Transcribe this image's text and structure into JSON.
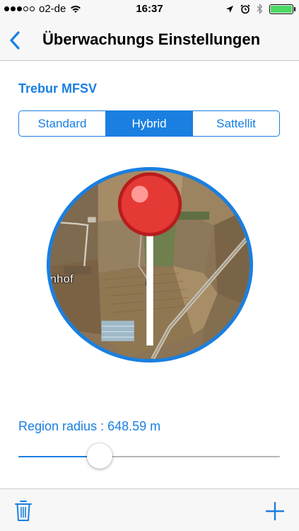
{
  "status_bar": {
    "signal_filled": 3,
    "signal_total": 5,
    "carrier": "o2-de",
    "time": "16:37",
    "icons": [
      "wifi-icon",
      "location-arrow-icon",
      "alarm-icon",
      "bluetooth-icon",
      "battery-icon"
    ],
    "battery_level": 1.0
  },
  "nav": {
    "title": "Überwachungs Einstellungen",
    "back_icon": "chevron-left-icon"
  },
  "location_name": "Trebur MFSV",
  "map_type": {
    "options": [
      "Standard",
      "Hybrid",
      "Sattellit"
    ],
    "selected_index": 1
  },
  "map": {
    "place_label": "kenhof",
    "pin_icon": "map-pin-icon"
  },
  "region": {
    "label": "Region radius : 648.59 m",
    "slider_value": 0.31
  },
  "toolbar": {
    "delete_icon": "trash-icon",
    "add_icon": "plus-icon"
  },
  "colors": {
    "accent": "#1a7fe0",
    "pin": "#e53935"
  }
}
